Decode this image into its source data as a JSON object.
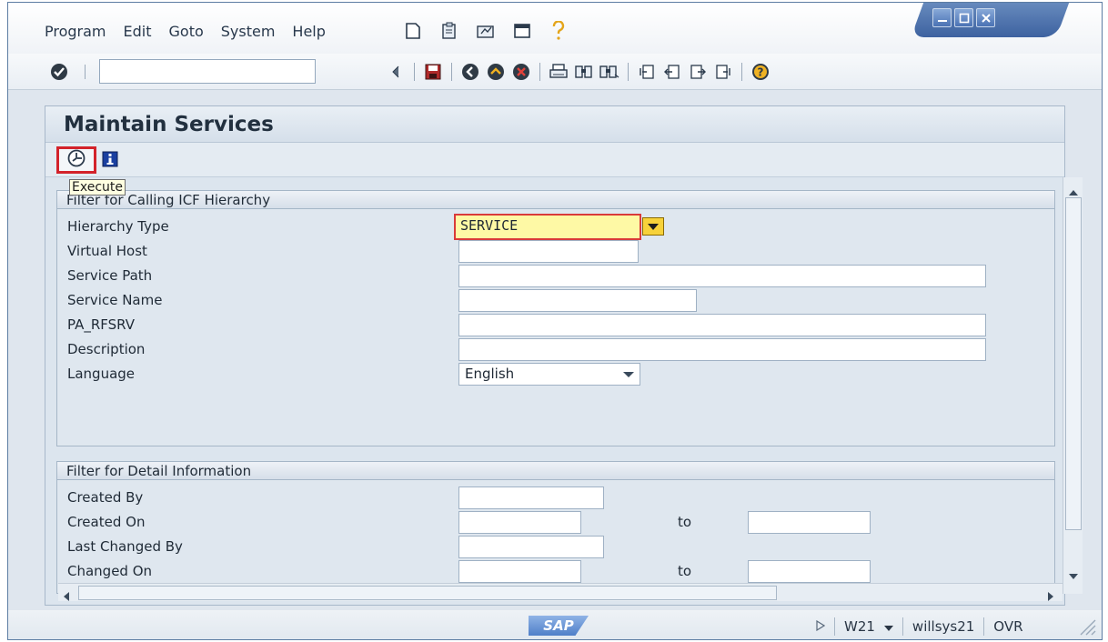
{
  "menubar": {
    "items": [
      "Program",
      "Edit",
      "Goto",
      "System",
      "Help"
    ]
  },
  "page": {
    "title": "Maintain Services",
    "tooltip": "Execute"
  },
  "filter_icf": {
    "heading": "Filter for Calling ICF Hierarchy",
    "hierarchy_type_label": "Hierarchy Type",
    "hierarchy_type_value": "SERVICE",
    "virtual_host_label": "Virtual Host",
    "service_path_label": "Service Path",
    "service_name_label": "Service Name",
    "pa_rfsrv_label": "PA_RFSRV",
    "description_label": "Description",
    "language_label": "Language",
    "language_value": "English"
  },
  "filter_detail": {
    "heading": "Filter for Detail Information",
    "created_by_label": "Created By",
    "created_on_label": "Created On",
    "to_label": "to",
    "last_changed_by_label": "Last Changed By",
    "changed_on_label": "Changed On"
  },
  "statusbar": {
    "logo": "SAP",
    "system": "W21",
    "server": "willsys21",
    "mode": "OVR"
  },
  "colors": {
    "accent": "#d3222a",
    "highlight_field": "#fef9a5",
    "frame": "#5c7da3"
  }
}
